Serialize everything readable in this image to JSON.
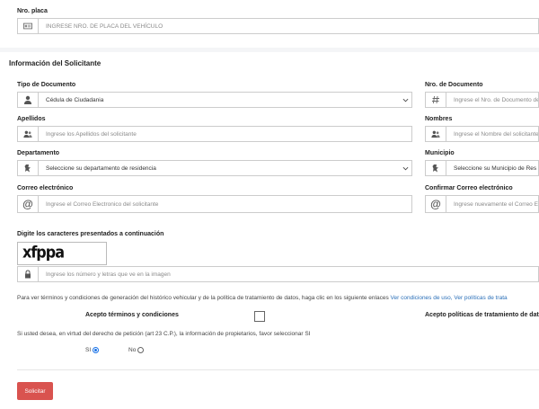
{
  "plate": {
    "label": "Nro. placa",
    "placeholder": "INGRESE NRO. DE PLACA DEL VEHÍCULO"
  },
  "applicant": {
    "section_title": "Información del Solicitante",
    "doc_type": {
      "label": "Tipo de Documento",
      "value": "Cédula de Ciudadania"
    },
    "doc_number": {
      "label": "Nro. de Documento",
      "placeholder": "Ingrese el Nro. de Documento de"
    },
    "surnames": {
      "label": "Apellidos",
      "placeholder": "Ingrese los Apellidos del solicitante"
    },
    "names": {
      "label": "Nombres",
      "placeholder": "Ingrese el Nombre del solicitante"
    },
    "department": {
      "label": "Departamento",
      "value": "Seleccione su departamento de residencia"
    },
    "municipality": {
      "label": "Municipio",
      "value": "Seleccione su Municipio de Res"
    },
    "email": {
      "label": "Correo electrónico",
      "placeholder": "Ingrese el Correo Electronico del solicitante"
    },
    "email_confirm": {
      "label": "Confirmar Correo electrónico",
      "placeholder": "Ingrese nuevamente el Correo E"
    }
  },
  "captcha": {
    "label": "Digite los caracteres presentados a continuación",
    "code": "xfppa",
    "placeholder": "Ingrese los número y letras que ve en la imagen"
  },
  "terms": {
    "text": "Para ver términos y condiciones de generación del histórico vehicular y de la política de tratamiento de datos, haga clic en los siguiente enlaces",
    "link1": "Ver condiciones de uso,",
    "link2": "Ver políticas de trata",
    "accept_terms_label": "Acepto términos y condiciones",
    "accept_policy_label": "Acepto políticas de tratamiento de dat"
  },
  "owners": {
    "question": "Si usted desea, en virtud del derecho de petición (art 23 C.P.), la información de propietarios, favor seleccionar SI",
    "yes_label": "SI",
    "no_label": "No",
    "selected": "SI"
  },
  "submit": {
    "label": "Solicitar"
  },
  "icons": {
    "plate": "id-card-icon",
    "person": "user-icon",
    "hash": "hash-icon",
    "users": "users-icon",
    "map": "map-pin-icon",
    "at": "at-icon",
    "lock": "lock-icon"
  },
  "colors": {
    "submit": "#d9534f",
    "link": "#2a6fb8",
    "radio_selected": "#1a73e8"
  }
}
